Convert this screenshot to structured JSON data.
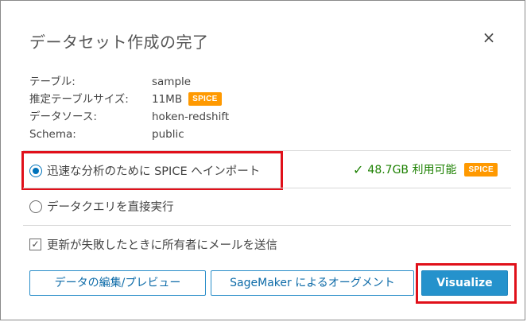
{
  "dialog": {
    "title": "データセット作成の完了",
    "close_label": "×"
  },
  "info": [
    {
      "label": "テーブル:",
      "value": "sample"
    },
    {
      "label": "推定テーブルサイズ:",
      "value": "11MB",
      "badge": "SPICE"
    },
    {
      "label": "データソース:",
      "value": "hoken-redshift"
    },
    {
      "label": "Schema:",
      "value": "public"
    }
  ],
  "options": {
    "spice_import": {
      "label": "迅速な分析のために SPICE へインポート",
      "selected": true
    },
    "direct_query": {
      "label": "データクエリを直接実行",
      "selected": false
    }
  },
  "availability": {
    "text": "48.7GB 利用可能",
    "badge": "SPICE",
    "color": "#1d8102"
  },
  "notify": {
    "label": "更新が失敗したときに所有者にメールを送信",
    "checked": true
  },
  "buttons": {
    "edit_preview": "データの編集/プレビュー",
    "sagemaker": "SageMaker によるオーグメント",
    "visualize": "Visualize"
  },
  "colors": {
    "primary": "#2592cc",
    "badge": "#ff9900",
    "highlight": "#e0101a"
  }
}
